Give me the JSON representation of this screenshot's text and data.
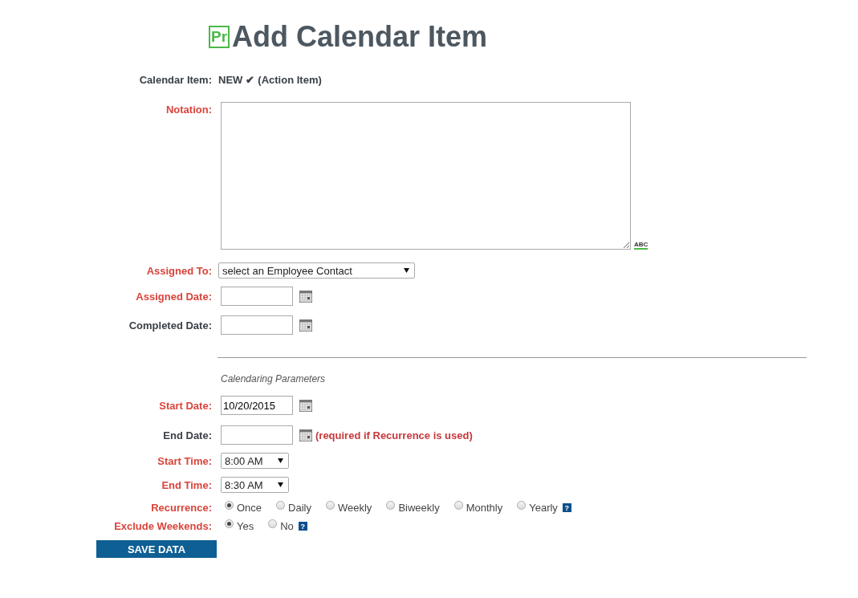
{
  "header": {
    "logo": "Pr",
    "title": "Add Calendar Item"
  },
  "item_status": {
    "label": "Calendar Item:",
    "value": "NEW",
    "check": "✔",
    "type": "(Action Item)"
  },
  "fields": [
    {
      "kind": "textarea",
      "label": "Notation:",
      "required": true,
      "spellcheck": "ABC"
    },
    {
      "kind": "select",
      "label": "Assigned To:",
      "required": true,
      "value": "select an Employee Contact"
    },
    {
      "kind": "date",
      "label": "Assigned Date:",
      "required": true
    },
    {
      "kind": "date",
      "label": "Completed Date:",
      "required": false
    }
  ],
  "section": {
    "title": "Calendaring Parameters"
  },
  "parameters": [
    {
      "kind": "date",
      "label": "Start Date:",
      "required": true,
      "value": "10/20/2015"
    },
    {
      "kind": "date",
      "label": "End Date:",
      "required": false,
      "note": "(required if Recurrence is used)"
    },
    {
      "kind": "time",
      "label": "Start Time:",
      "required": true,
      "value": "8:00 AM"
    },
    {
      "kind": "time",
      "label": "End Time:",
      "required": true,
      "value": "8:30 AM"
    },
    {
      "kind": "radio",
      "label": "Recurrence:",
      "required": true,
      "help": "?",
      "options": [
        {
          "label": "Once",
          "selected": true
        },
        {
          "label": "Daily",
          "selected": false
        },
        {
          "label": "Weekly",
          "selected": false
        },
        {
          "label": "Biweekly",
          "selected": false
        },
        {
          "label": "Monthly",
          "selected": false
        },
        {
          "label": "Yearly",
          "selected": false
        }
      ]
    },
    {
      "kind": "radio",
      "label": "Exclude Weekends:",
      "required": true,
      "help": "?",
      "options": [
        {
          "label": "Yes",
          "selected": true
        },
        {
          "label": "No",
          "selected": false
        }
      ]
    }
  ],
  "save_button": "SAVE DATA"
}
